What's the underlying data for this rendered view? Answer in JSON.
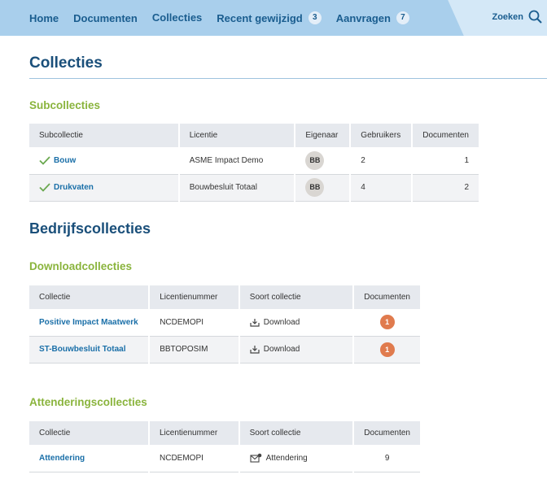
{
  "nav": {
    "items": [
      {
        "label": "Home"
      },
      {
        "label": "Documenten"
      },
      {
        "label": "Collecties"
      },
      {
        "label": "Recent gewijzigd",
        "badge": "3"
      },
      {
        "label": "Aanvragen",
        "badge": "7"
      }
    ],
    "search_label": "Zoeken"
  },
  "page_title": "Collecties",
  "subcollecties": {
    "heading": "Subcollecties",
    "columns": [
      "Subcollectie",
      "Licentie",
      "Eigenaar",
      "Gebruikers",
      "Documenten"
    ],
    "rows": [
      {
        "name": "Bouw",
        "licentie": "ASME Impact Demo",
        "eigenaar": "BB",
        "gebruikers": "2",
        "documenten": "1"
      },
      {
        "name": "Drukvaten",
        "licentie": "Bouwbesluit Totaal",
        "eigenaar": "BB",
        "gebruikers": "4",
        "documenten": "2"
      }
    ]
  },
  "bedrijfscollecties_heading": "Bedrijfscollecties",
  "downloadcollecties": {
    "heading": "Downloadcollecties",
    "columns": [
      "Collectie",
      "Licentienummer",
      "Soort collectie",
      "Documenten"
    ],
    "rows": [
      {
        "name": "Positive Impact Maatwerk",
        "licentienummer": "NCDEMOPI",
        "soort": "Download",
        "documenten": "1"
      },
      {
        "name": "ST-Bouwbesluit Totaal",
        "licentienummer": "BBTOPOSIM",
        "soort": "Download",
        "documenten": "1"
      }
    ]
  },
  "attenderingscollecties": {
    "heading": "Attenderingscollecties",
    "columns": [
      "Collectie",
      "Licentienummer",
      "Soort collectie",
      "Documenten"
    ],
    "rows": [
      {
        "name": "Attendering",
        "licentienummer": "NCDEMOPI",
        "soort": "Attendering",
        "documenten": "9"
      }
    ]
  },
  "colors": {
    "nav_bg": "#a9cfec",
    "nav_text": "#1a5d8f",
    "heading_blue": "#1a4f7a",
    "section_green": "#8ab43d",
    "badge_orange": "#e07b4e",
    "link_blue": "#1a6fa8"
  },
  "icons": {
    "search": "magnifier-icon",
    "check": "check-icon",
    "download": "download-tray-icon",
    "attendering": "mail-bell-icon"
  }
}
